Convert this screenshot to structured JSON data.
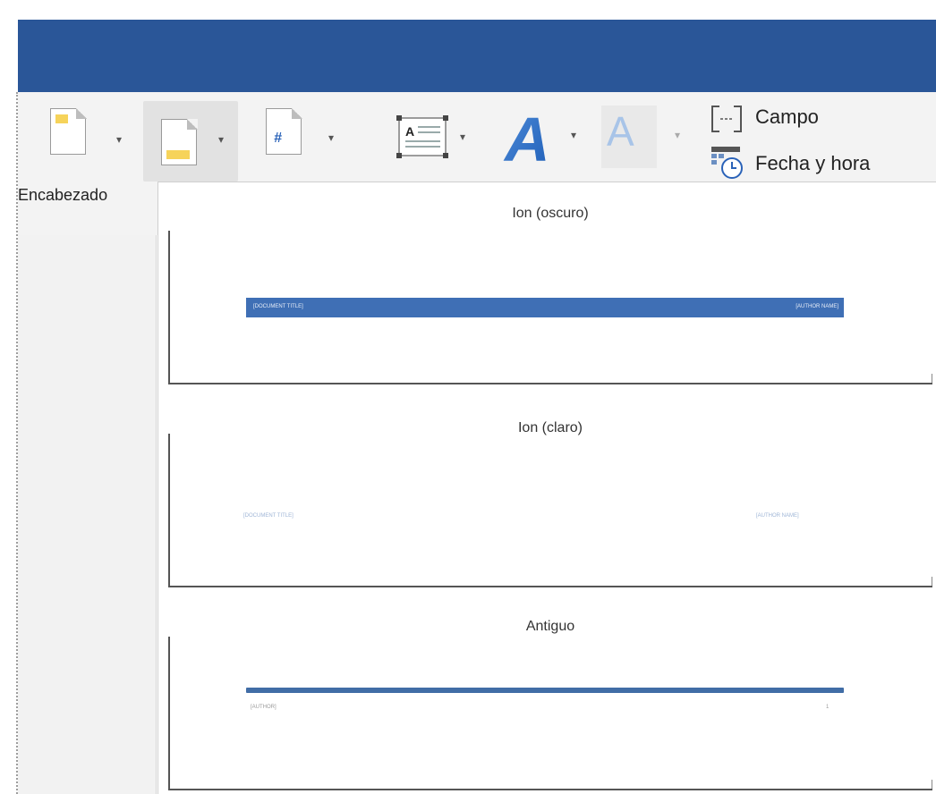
{
  "app": {
    "title_bar_color": "#2a5698",
    "accent": "#2a62b8"
  },
  "ribbon": {
    "header_button_label": "Encabezado",
    "field_label": "Campo",
    "datetime_label": "Fecha y hora",
    "icons": [
      "header-icon",
      "footer-icon",
      "page-number-icon",
      "text-box-icon",
      "wordart-icon",
      "drop-cap-icon",
      "field-icon",
      "date-time-icon"
    ]
  },
  "gallery": {
    "items": [
      {
        "title": "Ion (oscuro)",
        "left_placeholder": "[DOCUMENT TITLE]",
        "right_placeholder": "[AUTHOR NAME]"
      },
      {
        "title": "Ion (claro)",
        "left_placeholder": "[DOCUMENT TITLE]",
        "right_placeholder": "[AUTHOR NAME]"
      },
      {
        "title": "Antiguo",
        "left_placeholder": "[AUTHOR]",
        "right_placeholder": "1"
      }
    ]
  }
}
